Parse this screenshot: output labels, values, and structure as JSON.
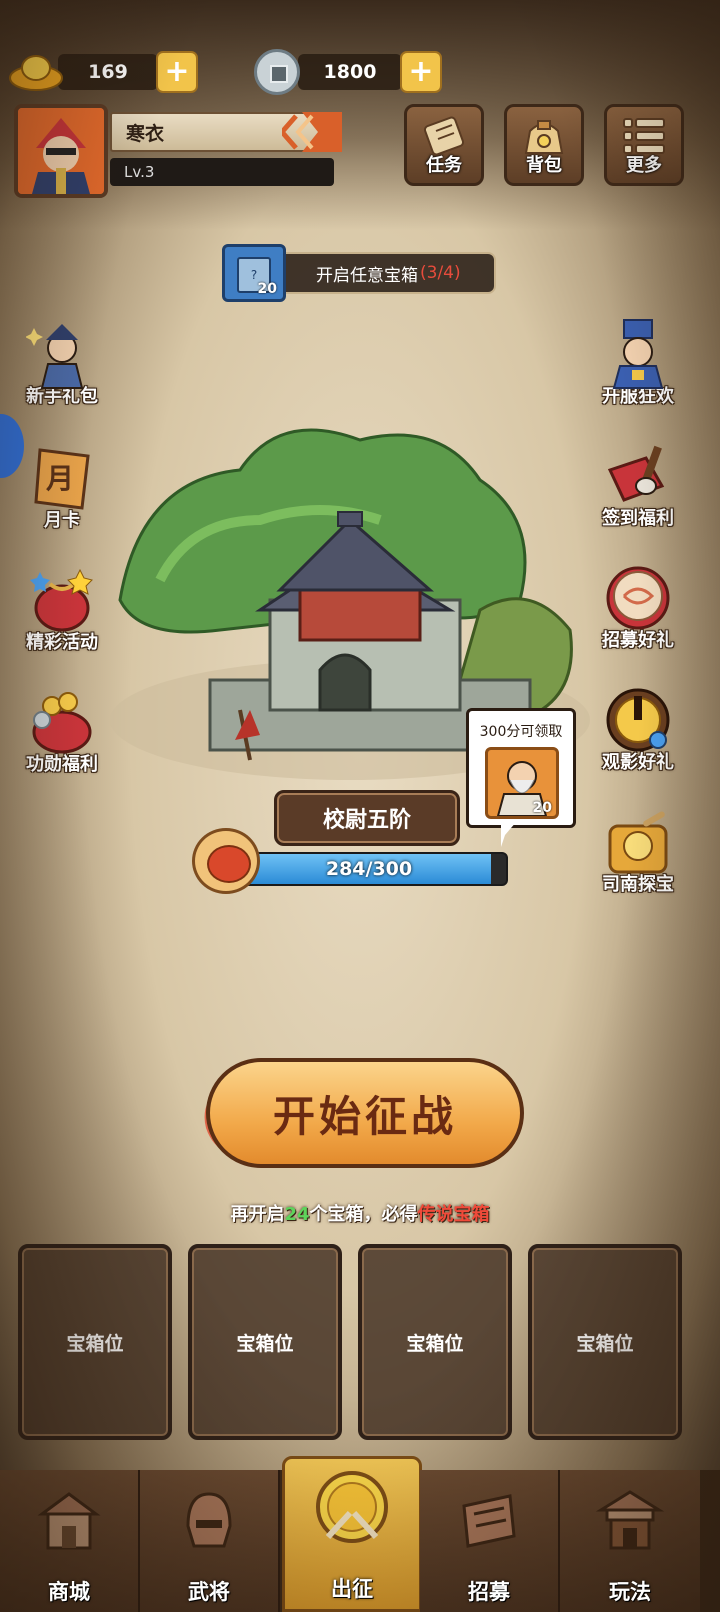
{
  "currency": {
    "gold": "169",
    "silver": "1800"
  },
  "player": {
    "name": "寒衣",
    "level": "Lv.3"
  },
  "top_buttons": [
    {
      "label": "任务",
      "icon": "scroll-icon"
    },
    {
      "label": "背包",
      "icon": "bag-icon"
    },
    {
      "label": "更多",
      "icon": "menu-icon"
    }
  ],
  "task_banner": {
    "count": "20",
    "text": "开启任意宝箱",
    "progress": "(3/4)"
  },
  "left_icons": [
    {
      "label": "新手礼包",
      "icon": "hero-gift-icon"
    },
    {
      "label": "月卡",
      "icon": "month-card-icon"
    },
    {
      "label": "精彩活动",
      "icon": "event-bag-icon"
    },
    {
      "label": "功勋福利",
      "icon": "merit-bag-icon"
    }
  ],
  "right_icons": [
    {
      "label": "开服狂欢",
      "icon": "carnival-icon"
    },
    {
      "label": "签到福利",
      "icon": "signin-icon"
    },
    {
      "label": "招募好礼",
      "icon": "drum-icon"
    },
    {
      "label": "观影好礼",
      "icon": "film-icon"
    },
    {
      "label": "司南探宝",
      "icon": "compass-icon"
    }
  ],
  "fortress": {
    "rank": "校尉五阶",
    "xp_text": "284/300",
    "xp_fraction": 0.9467
  },
  "reward_bubble": {
    "text": "300分可领取",
    "count": "20"
  },
  "start_button": "开始征战",
  "hint": {
    "prefix": "再开启",
    "number": "24",
    "middle": "个宝箱，必得",
    "highlight": "传说宝箱"
  },
  "chest_slots": [
    "宝箱位",
    "宝箱位",
    "宝箱位",
    "宝箱位"
  ],
  "nav": [
    {
      "label": "商城",
      "icon": "shop-icon"
    },
    {
      "label": "武将",
      "icon": "general-icon"
    },
    {
      "label": "出征",
      "icon": "battle-icon",
      "active": true
    },
    {
      "label": "招募",
      "icon": "recruit-icon"
    },
    {
      "label": "玩法",
      "icon": "gameplay-icon"
    }
  ]
}
